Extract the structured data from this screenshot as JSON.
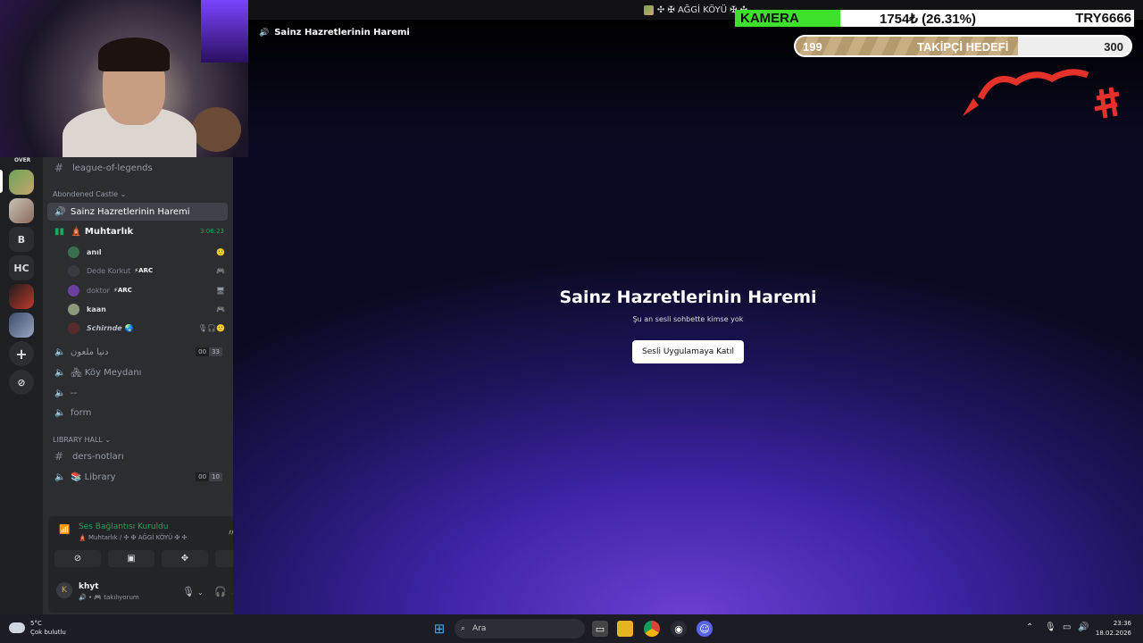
{
  "window": {
    "title": "✣ ✠ AĞGİ KÖYÜ ✠ ✣"
  },
  "webcam": {
    "tag": "OVER"
  },
  "rail": {
    "servers": [
      "B",
      "HC"
    ],
    "add_label": "+",
    "discover_label": "⊘"
  },
  "channels": {
    "top_channel": "league-of-legends",
    "categories": {
      "abandoned": "Abondened Castle ⌄",
      "library": "LIBRARY HALL ⌄"
    },
    "active_channel": "Sainz Hazretlerinin Haremi",
    "voice_channel": {
      "name": "🛕 Muhtarlık",
      "time": "3:06:23"
    },
    "voice_users": [
      {
        "name": "anıl",
        "status": "🙂"
      },
      {
        "name": "Dede Korkut",
        "badge": "⚡ARC",
        "status": "🎮"
      },
      {
        "name": "doktor",
        "badge": "⚡ARC",
        "status": "🖥"
      },
      {
        "name": "kaan",
        "status": "🎮"
      },
      {
        "name": "𝙎𝙘𝙝𝙞𝙧𝙣𝙙𝙚 🌏",
        "status": "🎙🎧🙂"
      }
    ],
    "other": [
      {
        "name": "دنيا ملعون",
        "c1": "00",
        "c2": "33"
      },
      {
        "name": "🏘 Köy Meydanı"
      },
      {
        "name": "--"
      },
      {
        "name": "form"
      }
    ],
    "library_channels": [
      {
        "name": "ders-notları"
      },
      {
        "name": "📚 Library",
        "c1": "00",
        "c2": "10"
      }
    ]
  },
  "voice_panel": {
    "status": "Ses Bağlantısı Kuruldu",
    "location": "🛕 Muhtarlık / ✣ ✠ AĞGİ KÖYÜ ✠ ✣"
  },
  "user": {
    "name": "khyt",
    "status": "🔊 • 🎮 takılıyorum"
  },
  "stage": {
    "header": "Sainz Hazretlerinin Haremi",
    "title": "Sainz Hazretlerinin Haremi",
    "subtitle": "Şu an sesli sohbette kimse yok",
    "join_label": "Sesli Uygulamaya Katıl"
  },
  "overlay": {
    "camera_goal": {
      "label": "KAMERA",
      "amount": "1754₺ (26.31%)",
      "target": "TRY6666",
      "progress": 0.2631
    },
    "follower_goal": {
      "current": "199",
      "label": "TAKİPÇİ HEDEFİ",
      "target": "300",
      "progress": 0.663
    }
  },
  "taskbar": {
    "weather_temp": "5°C",
    "weather_desc": "Çok bulutlu",
    "search_placeholder": "Ara",
    "time": "23:36",
    "date": "18.02.2026"
  },
  "colors": {
    "accent": "#5865f2",
    "online": "#23a55a",
    "camera_fill": "#3de02a"
  }
}
